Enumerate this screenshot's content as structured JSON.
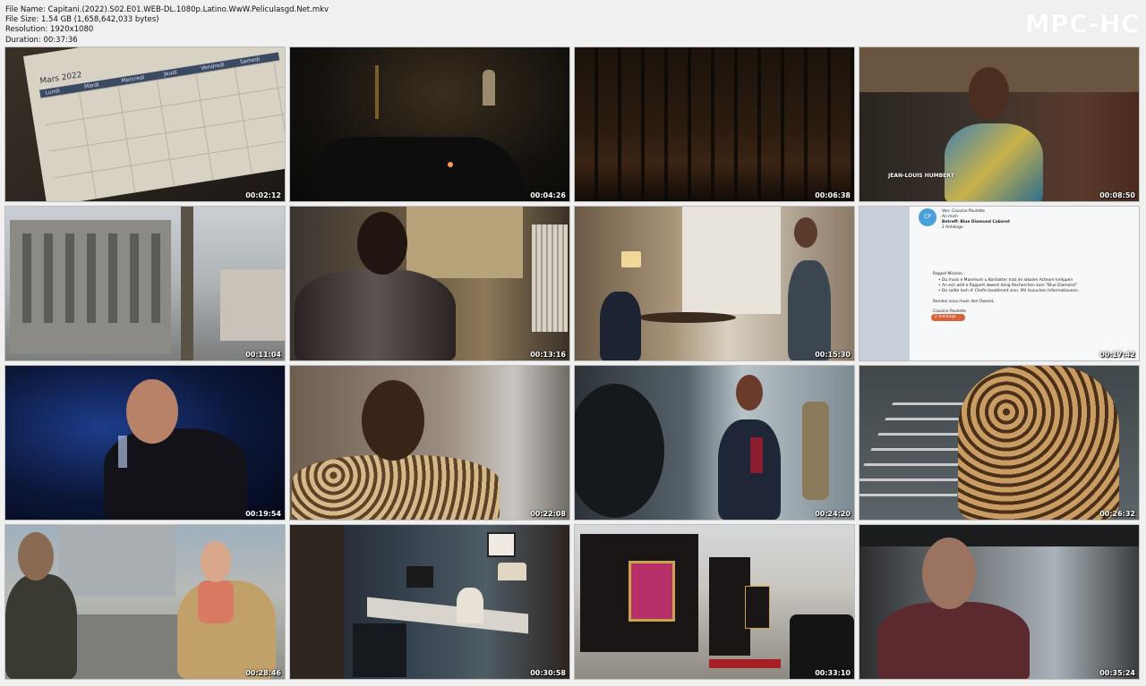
{
  "file_info": {
    "name": "File Name: Capitani.(2022).S02.E01.WEB-DL.1080p.Latino.WwW.Peliculasgd.Net.mkv",
    "size": "File Size: 1.54 GB (1,658,642,033 bytes)",
    "resolution": "Resolution: 1920x1080",
    "duration": "Duration: 00:37:36"
  },
  "logo": "MPC-HC",
  "thumbnails": [
    {
      "time": "00:02:12"
    },
    {
      "time": "00:04:26"
    },
    {
      "time": "00:06:38"
    },
    {
      "time": "00:08:50",
      "caption": "JEAN-LOUIS HUMBERT"
    },
    {
      "time": "00:11:04"
    },
    {
      "time": "00:13:16"
    },
    {
      "time": "00:15:30"
    },
    {
      "time": "00:17:42"
    },
    {
      "time": "00:19:54"
    },
    {
      "time": "00:22:08"
    },
    {
      "time": "00:24:20"
    },
    {
      "time": "00:26:32"
    },
    {
      "time": "00:28:46"
    },
    {
      "time": "00:30:58"
    },
    {
      "time": "00:33:10"
    },
    {
      "time": "00:35:24"
    }
  ],
  "calendar": {
    "month": "Mars 2022",
    "days": [
      "Lundi",
      "Mardi",
      "Mercredi",
      "Jeudi",
      "Vendredi",
      "Samedi"
    ]
  },
  "email": {
    "avatar": "CP",
    "from": "Von: Cousine Paulette",
    "to": "An mich",
    "subject": "Betreff: Blue Diamond Cabaret",
    "attachments": "2 Anhänge",
    "lines": [
      "Rappel Mission :",
      "• Du muss e Maximum u Kontakter mat de lokalen Acteure knëppen",
      "• An ech wëll e Rapport iwwert deng Recherchen zum \"Blue Diamond\"",
      "• Do sollte Iech d' Chefin bestëmmt sinn. Mir brauchen Informatiounen.",
      "Rendez vous muer den Owend,",
      "Cousine Paulette"
    ],
    "button": "2 Anhänge"
  }
}
